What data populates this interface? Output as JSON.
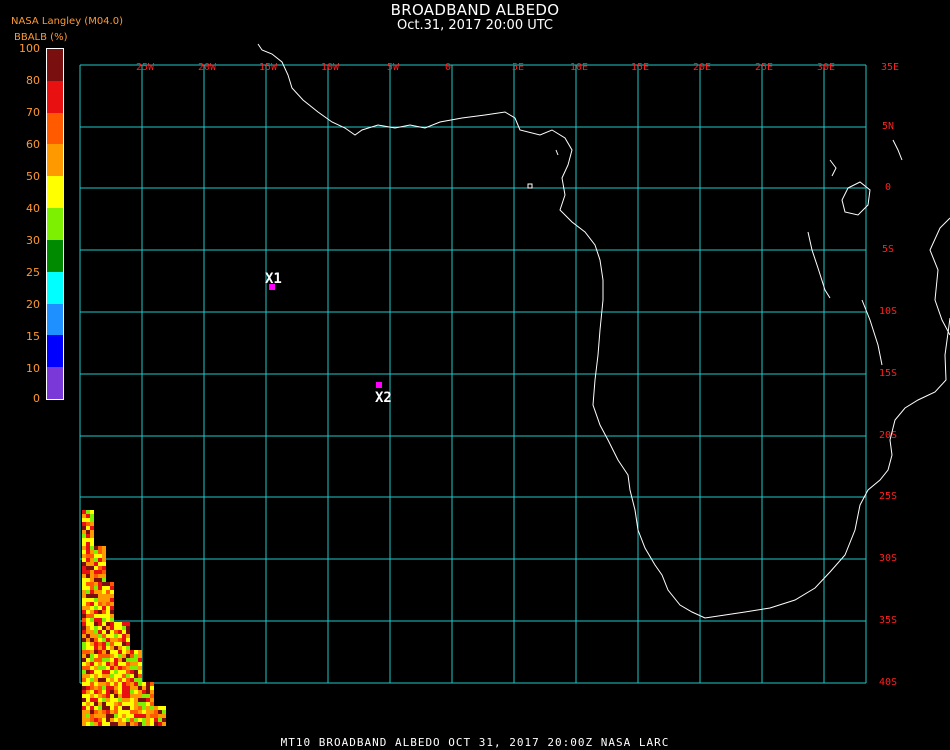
{
  "header": {
    "title": "BROADBAND ALBEDO",
    "subtitle": "Oct.31, 2017 20:00 UTC"
  },
  "colorbar": {
    "source_label": "NASA Langley (M04.0)",
    "unit_label": "BBALB (%)",
    "ticks": [
      "100",
      "80",
      "70",
      "60",
      "50",
      "40",
      "30",
      "25",
      "20",
      "15",
      "10",
      "0"
    ],
    "colors": [
      "#7a0f0f",
      "#e81010",
      "#ff5a00",
      "#ff9900",
      "#ffff00",
      "#7cf000",
      "#008a00",
      "#00ffff",
      "#1e90ff",
      "#0000ff",
      "#7a38d8"
    ]
  },
  "map": {
    "lon_labels": [
      "25W",
      "20W",
      "15W",
      "10W",
      "5W",
      "0",
      "5E",
      "10E",
      "15E",
      "20E",
      "25E",
      "30E",
      "35E"
    ],
    "lat_labels": [
      "5N",
      "0",
      "5S",
      "10S",
      "15S",
      "20S",
      "25S",
      "30S",
      "35S",
      "40S"
    ],
    "grid_color": "#20c8c8",
    "label_color": "#ff2020",
    "markers": [
      {
        "label": "X1",
        "color": "#ff00ff"
      },
      {
        "label": "X2",
        "color": "#ff00ff"
      }
    ]
  },
  "footer": "MT10  BROADBAND ALBEDO   OCT 31, 2017 20:00Z   NASA LARC"
}
